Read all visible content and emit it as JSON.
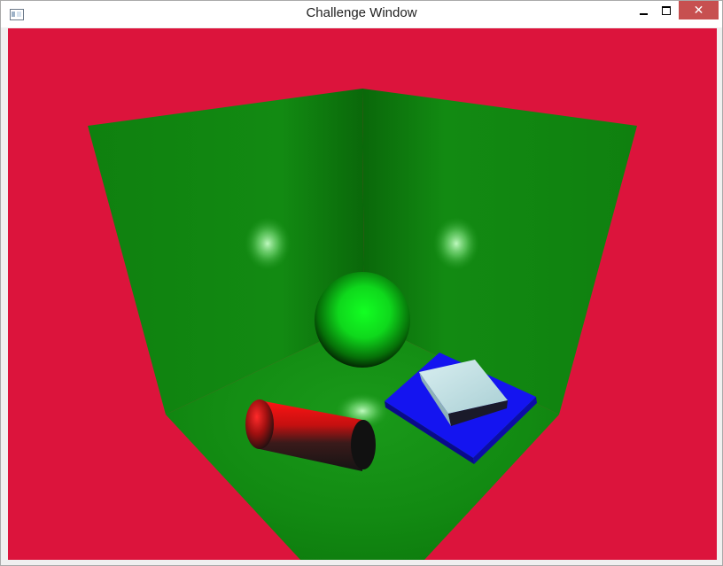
{
  "window": {
    "title": "Challenge Window",
    "icon": "window-app-icon",
    "controls": {
      "minimize_icon": "minimize-icon",
      "maximize_icon": "maximize-icon",
      "close_icon": "close-icon",
      "close_glyph": "✕"
    }
  },
  "scene": {
    "background_color": "#dc143c",
    "room_color": "#128a12",
    "sphere_color": "#10ff20",
    "cylinder_color": "#ff1010",
    "platform_color": "#1414f0",
    "cube_color": "#b9dde1"
  }
}
